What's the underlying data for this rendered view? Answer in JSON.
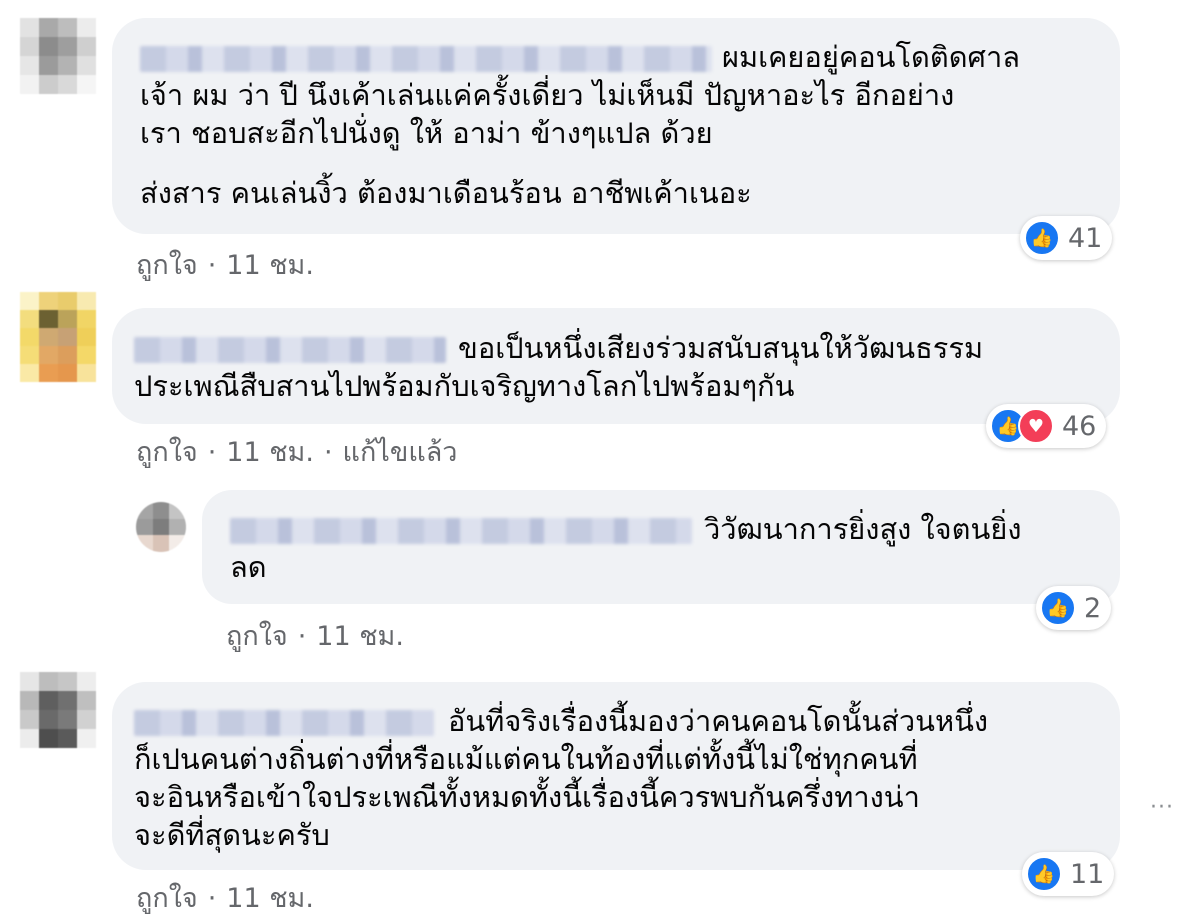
{
  "comments": [
    {
      "text_lines": [
        "ผมเคยอยู่คอนโดติดศาล",
        "เจ้า ผม ว่า ปี นึงเค้าเล่นแค่ครั้งเดี่ยว ไม่เห็นมี ปัญหาอะไร อีกอย่าง",
        "เรา ชอบสะอีกไปนั่งดู ให้ อาม่า ข้างๆแปล ด้วย"
      ],
      "text_para2": "ส่งสาร คนเล่นงิ้ว ต้องมาเดือนร้อน อาชีพเค้าเนอะ",
      "like_label": "ถูกใจ",
      "time": "11 ชม.",
      "reaction_count": "41",
      "reactions": [
        "like-icon"
      ]
    },
    {
      "text_lines": [
        "ขอเป็นหนึ่งเสียงร่วมสนับสนุนให้วัฒนธรรม",
        "ประเพณีสืบสานไปพร้อมกับเจริญทางโลกไปพร้อมๆกัน"
      ],
      "like_label": "ถูกใจ",
      "time": "11 ชม.",
      "edited": "แก้ไขแล้ว",
      "reaction_count": "46",
      "reactions": [
        "like-icon",
        "heart-icon"
      ]
    },
    {
      "text_lines": [
        "วิวัฒนาการยิ่งสูง ใจตนยิ่ง",
        "ลด"
      ],
      "like_label": "ถูกใจ",
      "time": "11 ชม.",
      "reaction_count": "2",
      "reactions": [
        "like-icon"
      ]
    },
    {
      "text_lines": [
        "อันที่จริงเรื่องนี้มองว่าคนคอนโดนั้นส่วนหนึ่ง",
        "ก็เปนคนต่างถิ่นต่างที่หรือแม้แต่คนในท้องที่แต่ทั้งนี้ไม่ใช่ทุกคนที่",
        "จะอินหรือเข้าใจประเพณีทั้งหมดทั้งนี้เรื่องนี้ควรพบกันครึ่งทางน่า",
        "จะดีที่สุดนะครับ"
      ],
      "like_label": "ถูกใจ",
      "time": "11 ชม.",
      "reaction_count": "11",
      "reactions": [
        "like-icon"
      ]
    }
  ],
  "separator": "·",
  "more_options": "···"
}
